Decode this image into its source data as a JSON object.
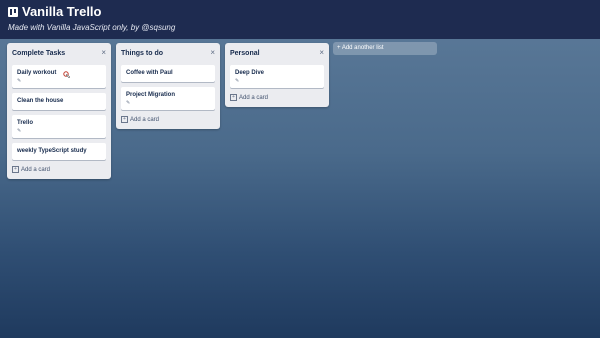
{
  "header": {
    "title": "Vanilla Trello",
    "subtitle": "Made with Vanilla JavaScript only, by @sqsung"
  },
  "lists": [
    {
      "title": "Complete Tasks",
      "close": "×",
      "cards": [
        {
          "title": "Daily workout",
          "meta": "✎"
        },
        {
          "title": "Clean the house",
          "meta": ""
        },
        {
          "title": "Trello",
          "meta": "✎"
        },
        {
          "title": "weekly TypeScript study",
          "meta": ""
        }
      ],
      "add_card": "Add a card"
    },
    {
      "title": "Things to do",
      "close": "×",
      "cards": [
        {
          "title": "Coffee with Paul",
          "meta": ""
        },
        {
          "title": "Project Migration",
          "meta": "✎"
        }
      ],
      "add_card": "Add a card"
    },
    {
      "title": "Personal",
      "close": "×",
      "cards": [
        {
          "title": "Deep Dive",
          "meta": "✎"
        }
      ],
      "add_card": "Add a card"
    }
  ],
  "add_list": "+ Add another list",
  "icons": {
    "add_card_icon": "+",
    "logo": "trello-logo-icon",
    "cursor": "hand-pointer-icon"
  },
  "colors": {
    "header_bg": "#1e2b50",
    "list_bg": "#ebecf0",
    "card_bg": "#ffffff",
    "board_gradient_top": "#5d7b9a",
    "board_gradient_bottom": "#1f3a5e"
  }
}
